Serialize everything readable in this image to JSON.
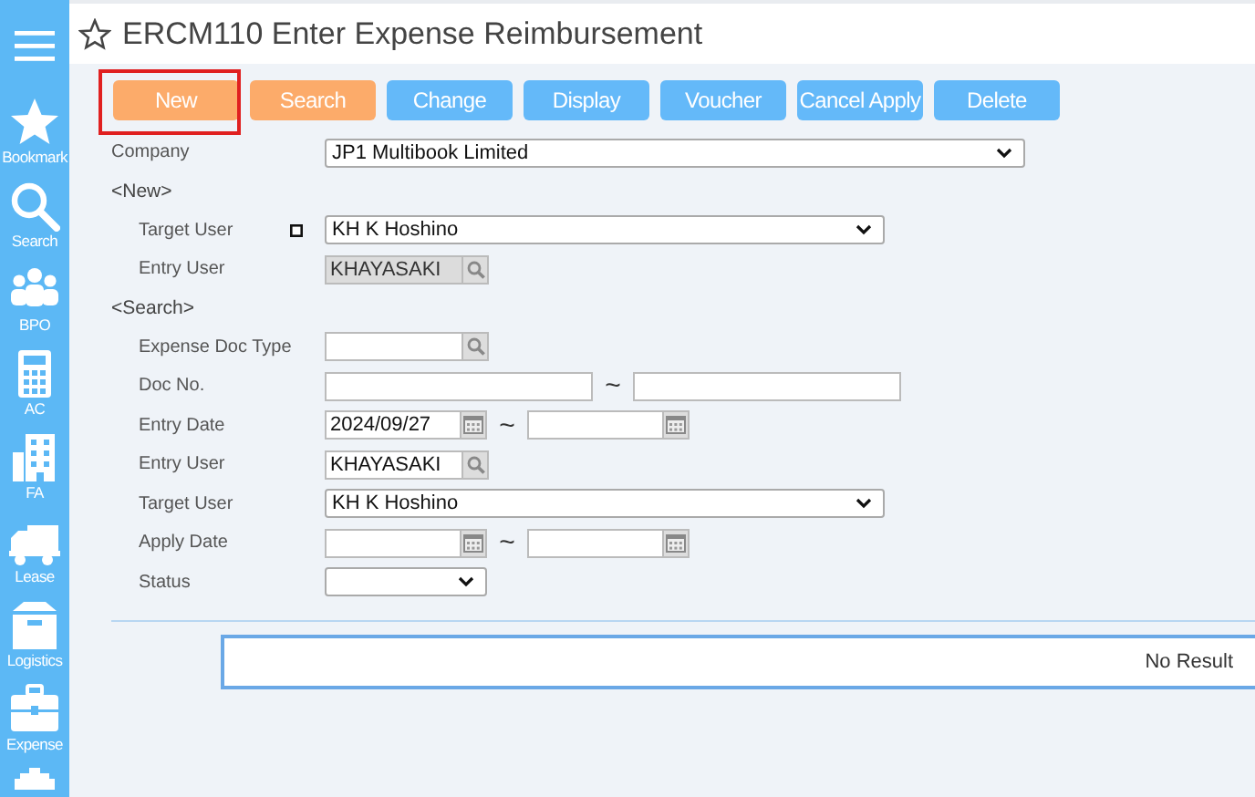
{
  "title": "ERCM110 Enter Expense Reimbursement",
  "sidebar": [
    {
      "label": "Bookmark"
    },
    {
      "label": "Search"
    },
    {
      "label": "BPO"
    },
    {
      "label": "AC"
    },
    {
      "label": "FA"
    },
    {
      "label": "Lease"
    },
    {
      "label": "Logistics"
    },
    {
      "label": "Expense"
    }
  ],
  "buttons": [
    {
      "label": "New",
      "kind": "orange",
      "highlighted": true
    },
    {
      "label": "Search",
      "kind": "orange",
      "highlighted": false
    },
    {
      "label": "Change",
      "kind": "blue",
      "highlighted": false
    },
    {
      "label": "Display",
      "kind": "blue",
      "highlighted": false
    },
    {
      "label": "Voucher",
      "kind": "blue",
      "highlighted": false
    },
    {
      "label": "Cancel Apply",
      "kind": "blue",
      "highlighted": false
    },
    {
      "label": "Delete",
      "kind": "blue",
      "highlighted": false
    }
  ],
  "company": {
    "label": "Company",
    "value": "JP1 Multibook Limited"
  },
  "sections": [
    {
      "heading": "<New>",
      "fields": [
        {
          "kind": "select",
          "label": "Target User",
          "value": "KH K Hoshino",
          "marker": true
        },
        {
          "kind": "lookup",
          "label": "Entry User",
          "value": "KHAYASAKI",
          "disabled": true
        }
      ]
    },
    {
      "heading": "<Search>",
      "fields": [
        {
          "kind": "lookup",
          "label": "Expense Doc Type",
          "disabled": false
        },
        {
          "kind": "range",
          "label": "Doc No.",
          "separator": "~"
        },
        {
          "kind": "date-range",
          "label": "Entry Date",
          "value": "2024/09/27",
          "separator": "~"
        },
        {
          "kind": "lookup",
          "label": "Entry User",
          "value": "KHAYASAKI",
          "disabled": false
        },
        {
          "kind": "select",
          "label": "Target User",
          "value": "KH K Hoshino"
        },
        {
          "kind": "date-range",
          "label": "Apply Date",
          "separator": "~"
        },
        {
          "kind": "short-select",
          "label": "Status"
        }
      ]
    }
  ],
  "result": {
    "message": "No Result"
  }
}
